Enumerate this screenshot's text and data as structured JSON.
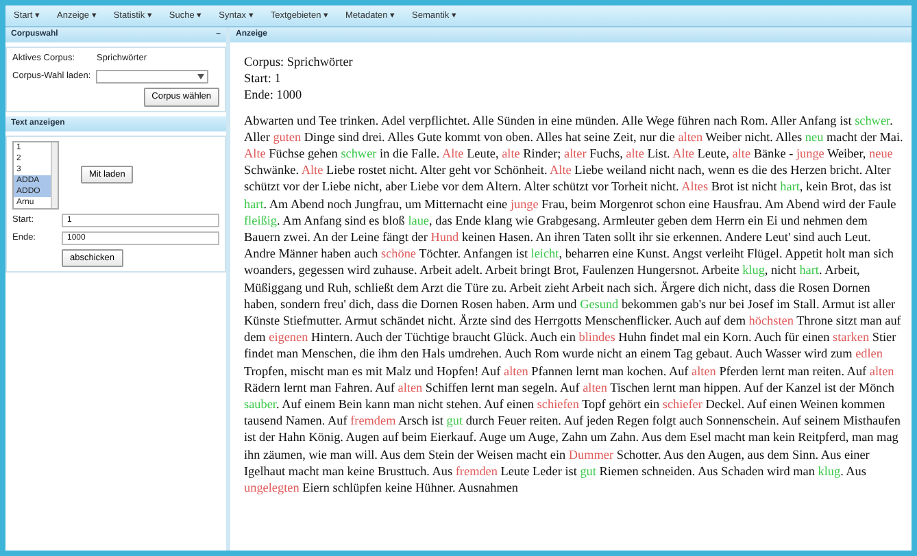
{
  "menu": [
    {
      "label": "Start ▾"
    },
    {
      "label": "Anzeige ▾"
    },
    {
      "label": "Statistik ▾"
    },
    {
      "label": "Suche ▾"
    },
    {
      "label": "Syntax ▾"
    },
    {
      "label": "Textgebieten ▾"
    },
    {
      "label": "Metadaten ▾"
    },
    {
      "label": "Semantik ▾"
    }
  ],
  "corpus_panel": {
    "title": "Corpuswahl",
    "collapse": "–",
    "active_label": "Aktives Corpus:",
    "active_value": "Sprichwörter",
    "load_label": "Corpus-Wahl laden:",
    "button": "Corpus wählen"
  },
  "text_panel": {
    "title": "Text anzeigen",
    "items": [
      {
        "label": "1",
        "selected": false
      },
      {
        "label": "2",
        "selected": false
      },
      {
        "label": "3",
        "selected": false
      },
      {
        "label": "ADDA",
        "selected": true
      },
      {
        "label": "ADDO",
        "selected": true
      },
      {
        "label": "Arnu",
        "selected": false
      }
    ],
    "load_button": "Mit laden",
    "start_label": "Start:",
    "start_value": "1",
    "end_label": "Ende:",
    "end_value": "1000",
    "submit_button": "abschicken"
  },
  "display_panel": {
    "title": "Anzeige",
    "header_lines": [
      "Corpus: Sprichwörter",
      "Start: 1",
      "Ende: 1000"
    ],
    "segments": [
      {
        "kind": "plain",
        "text": "Abwarten und Tee trinken. Adel verpflichtet. Alle Sünden in eine münden. Alle Wege führen nach Rom. Aller Anfang ist "
      },
      {
        "kind": "pos",
        "text": "schwer"
      },
      {
        "kind": "plain",
        "text": ". Aller "
      },
      {
        "kind": "neg",
        "text": "guten"
      },
      {
        "kind": "plain",
        "text": " Dinge sind drei. Alles Gute kommt von oben. Alles hat seine Zeit, nur die "
      },
      {
        "kind": "neg",
        "text": "alten"
      },
      {
        "kind": "plain",
        "text": " Weiber nicht. Alles "
      },
      {
        "kind": "pos",
        "text": "neu"
      },
      {
        "kind": "plain",
        "text": " macht der Mai. "
      },
      {
        "kind": "neg",
        "text": "Alte"
      },
      {
        "kind": "plain",
        "text": " Füchse gehen "
      },
      {
        "kind": "pos",
        "text": "schwer"
      },
      {
        "kind": "plain",
        "text": " in die Falle. "
      },
      {
        "kind": "neg",
        "text": "Alte"
      },
      {
        "kind": "plain",
        "text": " Leute, "
      },
      {
        "kind": "neg",
        "text": "alte"
      },
      {
        "kind": "plain",
        "text": " Rinder; "
      },
      {
        "kind": "neg",
        "text": "alter"
      },
      {
        "kind": "plain",
        "text": " Fuchs, "
      },
      {
        "kind": "neg",
        "text": "alte"
      },
      {
        "kind": "plain",
        "text": " List. "
      },
      {
        "kind": "neg",
        "text": "Alte"
      },
      {
        "kind": "plain",
        "text": " Leute, "
      },
      {
        "kind": "neg",
        "text": "alte"
      },
      {
        "kind": "plain",
        "text": " Bänke - "
      },
      {
        "kind": "neg",
        "text": "junge"
      },
      {
        "kind": "plain",
        "text": " Weiber, "
      },
      {
        "kind": "neg",
        "text": "neue"
      },
      {
        "kind": "plain",
        "text": " Schwänke. "
      },
      {
        "kind": "neg",
        "text": "Alte"
      },
      {
        "kind": "plain",
        "text": " Liebe rostet nicht. Alter geht vor Schönheit. "
      },
      {
        "kind": "neg",
        "text": "Alte"
      },
      {
        "kind": "plain",
        "text": " Liebe weiland nicht nach, wenn es die des Herzen bricht. Alter schützt vor der Liebe nicht, aber Liebe vor dem Altern. Alter schützt vor Torheit nicht. "
      },
      {
        "kind": "neg",
        "text": "Altes"
      },
      {
        "kind": "plain",
        "text": " Brot ist nicht "
      },
      {
        "kind": "pos",
        "text": "hart"
      },
      {
        "kind": "plain",
        "text": ", kein Brot, das ist "
      },
      {
        "kind": "pos",
        "text": "hart"
      },
      {
        "kind": "plain",
        "text": ". Am Abend noch Jungfrau, um Mitternacht eine "
      },
      {
        "kind": "neg",
        "text": "junge"
      },
      {
        "kind": "plain",
        "text": " Frau, beim Morgenrot schon eine Hausfrau. Am Abend wird der Faule "
      },
      {
        "kind": "pos",
        "text": "fleißig"
      },
      {
        "kind": "plain",
        "text": ". Am Anfang sind es bloß "
      },
      {
        "kind": "pos",
        "text": "laue"
      },
      {
        "kind": "plain",
        "text": ", das Ende klang wie Grabgesang. Armleuter geben dem Herrn ein Ei und nehmen dem Bauern zwei. An der Leine fängt der "
      },
      {
        "kind": "neg",
        "text": "Hund"
      },
      {
        "kind": "plain",
        "text": " keinen Hasen. An ihren Taten sollt ihr sie erkennen. Andere Leut' sind auch Leut. Andre Männer haben auch "
      },
      {
        "kind": "neg",
        "text": "schöne"
      },
      {
        "kind": "plain",
        "text": " Töchter. Anfangen ist "
      },
      {
        "kind": "pos",
        "text": "leicht"
      },
      {
        "kind": "plain",
        "text": ", beharren eine Kunst. Angst verleiht Flügel. Appetit holt man sich woanders, gegessen wird zuhause. Arbeit adelt. Arbeit bringt Brot, Faulenzen Hungersnot. Arbeite "
      },
      {
        "kind": "pos",
        "text": "klug"
      },
      {
        "kind": "plain",
        "text": ", nicht "
      },
      {
        "kind": "pos",
        "text": "hart"
      },
      {
        "kind": "plain",
        "text": ". Arbeit, Müßiggang und Ruh, schließt dem Arzt die Türe zu. Arbeit zieht Arbeit nach sich. Ärgere dich nicht, dass die Rosen Dornen haben, sondern freu' dich, dass die Dornen Rosen haben. Arm und "
      },
      {
        "kind": "pos",
        "text": "Gesund"
      },
      {
        "kind": "plain",
        "text": " bekommen gab's nur bei Josef im Stall. Armut ist aller Künste Stiefmutter. Armut schändet nicht. Ärzte sind des Herrgotts Menschenflicker. Auch auf dem "
      },
      {
        "kind": "neg",
        "text": "höchsten"
      },
      {
        "kind": "plain",
        "text": " Throne sitzt man auf dem "
      },
      {
        "kind": "neg",
        "text": "eigenen"
      },
      {
        "kind": "plain",
        "text": " Hintern. Auch der Tüchtige braucht Glück. Auch ein "
      },
      {
        "kind": "neg",
        "text": "blindes"
      },
      {
        "kind": "plain",
        "text": " Huhn findet mal ein Korn. Auch für einen "
      },
      {
        "kind": "neg",
        "text": "starken"
      },
      {
        "kind": "plain",
        "text": " Stier findet man Menschen, die ihm den Hals umdrehen. Auch Rom wurde nicht an einem Tag gebaut. Auch Wasser wird zum "
      },
      {
        "kind": "neg",
        "text": "edlen"
      },
      {
        "kind": "plain",
        "text": " Tropfen, mischt man es mit Malz und Hopfen! Auf "
      },
      {
        "kind": "neg",
        "text": "alten"
      },
      {
        "kind": "plain",
        "text": " Pfannen lernt man kochen. Auf "
      },
      {
        "kind": "neg",
        "text": "alten"
      },
      {
        "kind": "plain",
        "text": " Pferden lernt man reiten. Auf "
      },
      {
        "kind": "neg",
        "text": "alten"
      },
      {
        "kind": "plain",
        "text": " Rädern lernt man Fahren. Auf "
      },
      {
        "kind": "neg",
        "text": "alten"
      },
      {
        "kind": "plain",
        "text": " Schiffen lernt man segeln. Auf "
      },
      {
        "kind": "neg",
        "text": "alten"
      },
      {
        "kind": "plain",
        "text": " Tischen lernt man hippen. Auf der Kanzel ist der Mönch "
      },
      {
        "kind": "pos",
        "text": "sauber"
      },
      {
        "kind": "plain",
        "text": ". Auf einem Bein kann man nicht stehen. Auf einen "
      },
      {
        "kind": "neg",
        "text": "schiefen"
      },
      {
        "kind": "plain",
        "text": " Topf gehört ein "
      },
      {
        "kind": "neg",
        "text": "schiefer"
      },
      {
        "kind": "plain",
        "text": " Deckel. Auf einen Weinen kommen tausend Namen. Auf "
      },
      {
        "kind": "neg",
        "text": "fremdem"
      },
      {
        "kind": "plain",
        "text": " Arsch ist "
      },
      {
        "kind": "pos",
        "text": "gut"
      },
      {
        "kind": "plain",
        "text": " durch Feuer reiten. Auf jeden Regen folgt auch Sonnenschein. Auf seinem Misthaufen ist der Hahn König. Augen auf beim Eierkauf. Auge um Auge, Zahn um Zahn. Aus dem Esel macht man kein Reitpferd, man mag ihn zäumen, wie man will. Aus dem Stein der Weisen macht ein "
      },
      {
        "kind": "neg",
        "text": "Dummer"
      },
      {
        "kind": "plain",
        "text": " Schotter. Aus den Augen, aus dem Sinn. Aus einer Igelhaut macht man keine Brusttuch. Aus "
      },
      {
        "kind": "neg",
        "text": "fremden"
      },
      {
        "kind": "plain",
        "text": " Leute Leder ist "
      },
      {
        "kind": "pos",
        "text": "gut"
      },
      {
        "kind": "plain",
        "text": " Riemen schneiden. Aus Schaden wird man "
      },
      {
        "kind": "pos",
        "text": "klug"
      },
      {
        "kind": "plain",
        "text": ". Aus "
      },
      {
        "kind": "neg",
        "text": "ungelegten"
      },
      {
        "kind": "plain",
        "text": " Eiern schlüpfen keine Hühner. Ausnahmen"
      }
    ]
  }
}
